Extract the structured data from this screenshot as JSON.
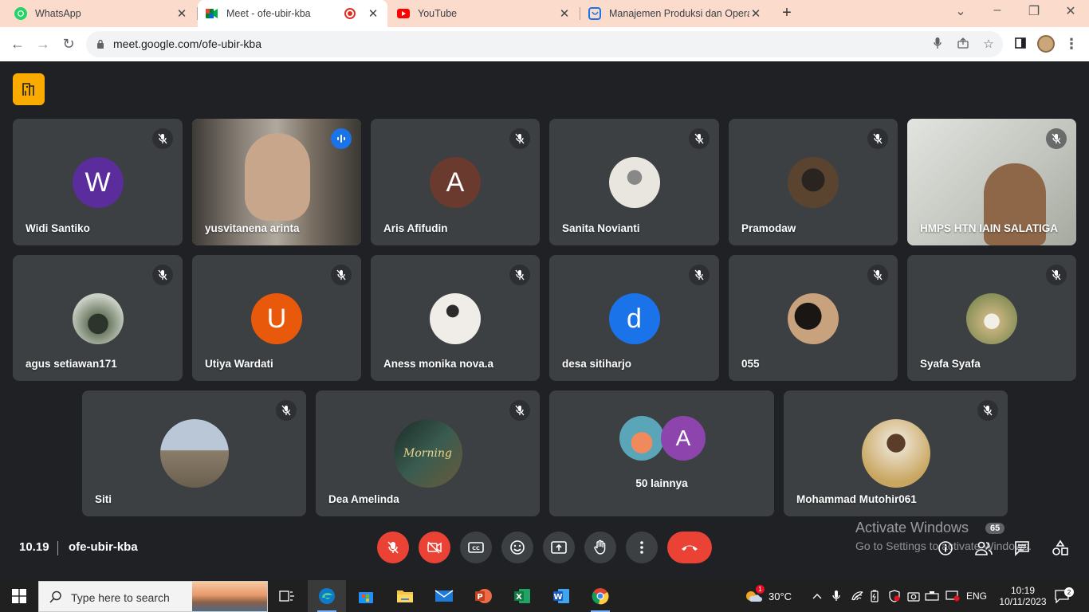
{
  "browser": {
    "tabs": [
      {
        "title": "WhatsApp",
        "icon": "whatsapp-icon",
        "active": false
      },
      {
        "title": "Meet - ofe-ubir-kba",
        "icon": "google-meet-icon",
        "active": true,
        "recording": true
      },
      {
        "title": "YouTube",
        "icon": "youtube-icon",
        "active": false
      },
      {
        "title": "Manajemen Produksi dan Opera",
        "icon": "elearning-icon",
        "active": false
      }
    ],
    "url": "meet.google.com/ofe-ubir-kba"
  },
  "meet": {
    "participants": [
      {
        "name": "Widi Santiko",
        "initial": "W",
        "color": "#5b2d9c",
        "muted": true
      },
      {
        "name": "yusvitanena arinta",
        "initial": "",
        "color": "#6b6258",
        "speaking": true,
        "video": true
      },
      {
        "name": "Aris Afifudin",
        "initial": "A",
        "color": "#6b3a2f",
        "muted": true
      },
      {
        "name": "Sanita Novianti",
        "initial": "",
        "color": "#c9c6c0",
        "muted": true
      },
      {
        "name": "Pramodaw",
        "initial": "",
        "color": "#4a3a2a",
        "muted": true
      },
      {
        "name": "HMPS HTN IAIN SALATIGA",
        "initial": "",
        "color": "#b9bcb6",
        "muted": true,
        "video": true
      },
      {
        "name": "agus setiawan171",
        "initial": "",
        "color": "#4d5a48",
        "muted": true
      },
      {
        "name": "Utiya Wardati",
        "initial": "U",
        "color": "#e8590c",
        "muted": true
      },
      {
        "name": "Aness monika nova.a",
        "initial": "",
        "color": "#d8d4d0",
        "muted": true
      },
      {
        "name": "desa sitiharjo",
        "initial": "d",
        "color": "#1a73e8",
        "muted": true
      },
      {
        "name": "055",
        "initial": "",
        "color": "#2a2420",
        "muted": true
      },
      {
        "name": "Syafa Syafa",
        "initial": "",
        "color": "#cbb98f",
        "muted": true
      },
      {
        "name": "Siti",
        "initial": "",
        "color": "#9aa7b5",
        "muted": true
      },
      {
        "name": "Dea Amelinda",
        "initial": "",
        "color": "#2d4a44",
        "muted": true,
        "avatar_text": "Morning"
      },
      {
        "name": "Mohammad Mutohir061",
        "initial": "",
        "color": "#d4b67a",
        "muted": true
      }
    ],
    "others": {
      "label": "50 lainnya",
      "initial": "A"
    },
    "time": "10.19",
    "meeting_code": "ofe-ubir-kba",
    "participant_count": "65",
    "watermark": {
      "title": "Activate Windows",
      "subtitle": "Go to Settings to activate Windows."
    },
    "colors": {
      "end_call": "#ea4335",
      "background": "#202124",
      "tile": "#3c4043",
      "speaking_border": "#8ab4f8"
    }
  },
  "taskbar": {
    "search_placeholder": "Type here to search",
    "weather": "30°C",
    "weather_badge": "1",
    "language": "ENG",
    "clock_time": "10:19",
    "clock_date": "10/11/2023",
    "notification_count": "2"
  }
}
